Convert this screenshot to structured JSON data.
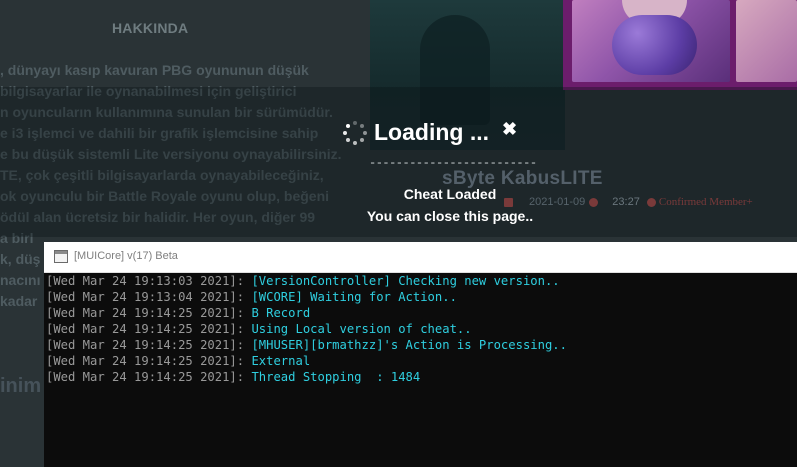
{
  "background": {
    "article_heading": "HAKKINDA",
    "article_lines": [
      ", dünyayı kasıp kavuran PBG oyununun düşük",
      "bilgisayarlar ile oynanabilmesi için geliştirici",
      "n oyuncuların kullanımına sunulan bir sürümüdür.",
      "e i3 işlemci ve dahili bir grafik işlemcisine sahip",
      "e bu düşük sistemli Lite versiyonu oynayabilirsiniz.",
      "TE, çok çeşitli bilgisayarlarda oynayabileceğiniz,",
      "ok oyunculu bir Battle Royale oyunu olup, beğeni",
      "ödül alan ücretsiz bir halidir. Her oyun, diğer 99",
      "a birl",
      "k, düş",
      "nacını",
      "kadar"
    ],
    "article_tail": "inim",
    "post_title": "sByte KabusLITE",
    "post_date": "2021-01-09",
    "post_time": "23:27",
    "post_member": "Confirmed Member+"
  },
  "overlay": {
    "title": "Loading ...",
    "close_symbol": "✖",
    "separator": "-------------------------",
    "message_line1": "Cheat Loaded",
    "message_line2": "You can close this page.."
  },
  "console": {
    "window_title": "[MUICore] v(17) Beta",
    "lines": [
      {
        "timestamp": "[Wed Mar 24 19:13:03 2021]: ",
        "text": "[VersionController] Checking new version.."
      },
      {
        "timestamp": "[Wed Mar 24 19:13:04 2021]: ",
        "text": "[WCORE] Waiting for Action.."
      },
      {
        "timestamp": "[Wed Mar 24 19:14:25 2021]: ",
        "text": "B Record"
      },
      {
        "timestamp": "[Wed Mar 24 19:14:25 2021]: ",
        "text": "Using Local version of cheat.."
      },
      {
        "timestamp": "[Wed Mar 24 19:14:25 2021]: ",
        "text": "[MHUSER][brmathzz]'s Action is Processing.."
      },
      {
        "timestamp": "[Wed Mar 24 19:14:25 2021]: ",
        "text": "External"
      },
      {
        "timestamp": "[Wed Mar 24 19:14:25 2021]: ",
        "text": "Thread Stopping  : 1484"
      }
    ]
  },
  "colors": {
    "console_background": "#0c0c0c",
    "console_timestamp": "#999999",
    "console_message": "#2fcfe0",
    "overlay_text": "#ffffff"
  },
  "icons": [
    "spinner-icon",
    "close-icon",
    "console-window-icon",
    "calendar-icon",
    "clock-icon",
    "member-badge-icon"
  ]
}
